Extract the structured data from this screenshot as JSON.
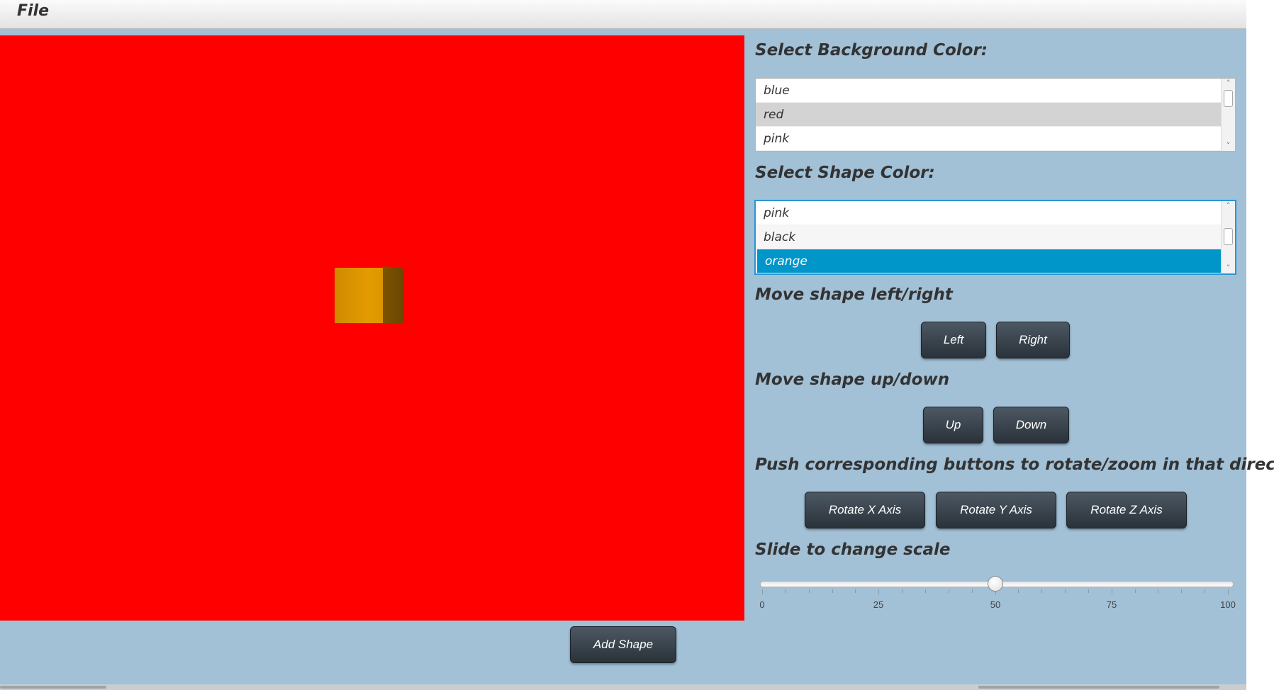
{
  "menu": {
    "file": "File"
  },
  "canvas": {
    "background": "#ff0000",
    "shape": "cube",
    "shape_color": "#e09400"
  },
  "bg_color": {
    "title": "Select Background Color:",
    "items": [
      "blue",
      "red",
      "pink"
    ],
    "selected": "red"
  },
  "shape_color": {
    "title": "Select Shape Color:",
    "items": [
      "pink",
      "black",
      "orange"
    ],
    "selected": "orange"
  },
  "move_lr": {
    "title": "Move shape left/right",
    "left": "Left",
    "right": "Right"
  },
  "move_ud": {
    "title": "Move shape up/down",
    "up": "Up",
    "down": "Down"
  },
  "rotate": {
    "title": "Push corresponding buttons to rotate/zoom in that direction",
    "x": "Rotate X Axis",
    "y": "Rotate Y Axis",
    "z": "Rotate Z Axis"
  },
  "scale": {
    "title": "Slide to change scale",
    "min": 0,
    "max": 100,
    "value": 50,
    "tick_labels": [
      "0",
      "25",
      "50",
      "75",
      "100"
    ]
  },
  "add_shape": "Add Shape"
}
